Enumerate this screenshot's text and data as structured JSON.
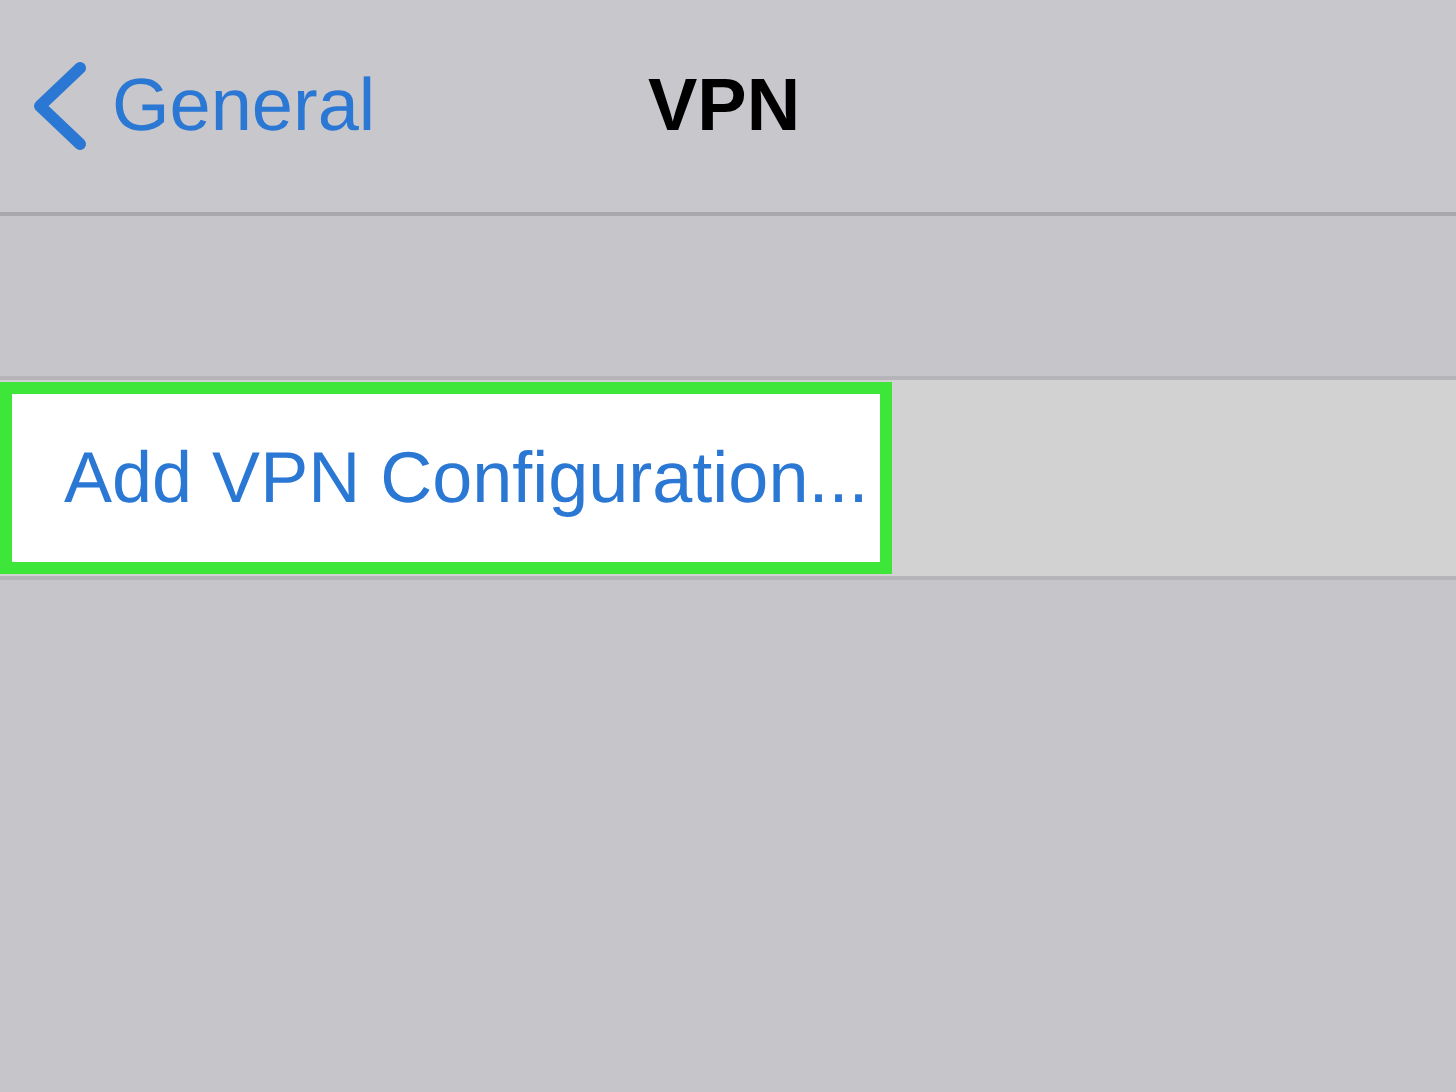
{
  "nav_bar": {
    "back_label": "General",
    "title": "VPN"
  },
  "rows": [
    {
      "label": "Add VPN Configuration...",
      "highlighted": true
    }
  ]
}
